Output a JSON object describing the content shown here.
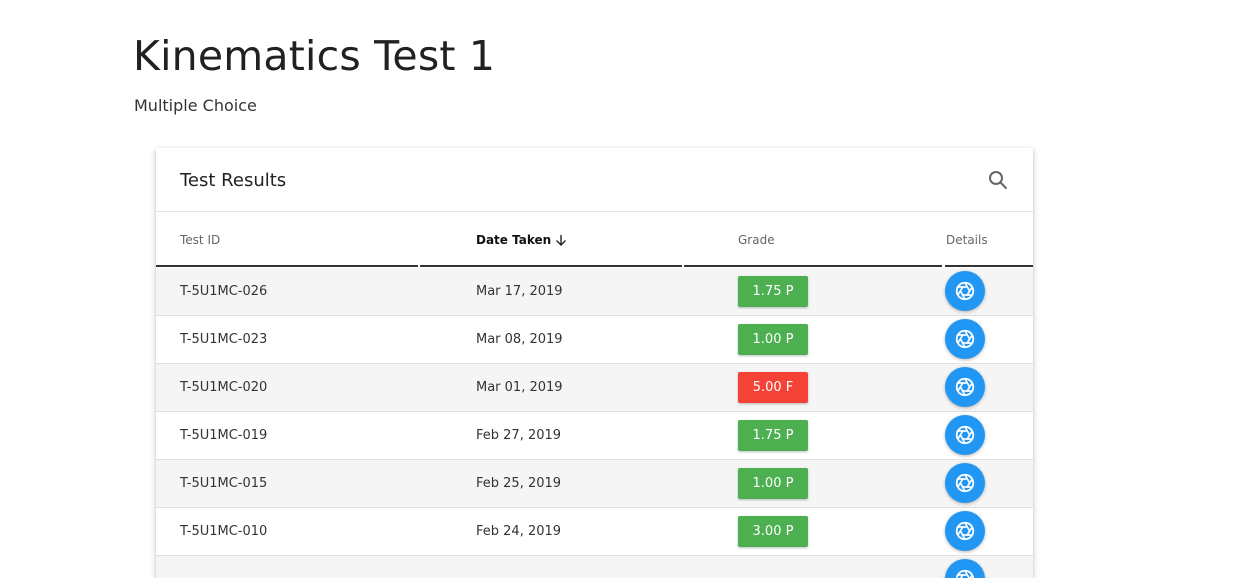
{
  "page": {
    "title": "Kinematics Test 1",
    "subtitle": "Multiple Choice"
  },
  "card": {
    "title": "Test Results",
    "search_icon": "search-icon"
  },
  "table": {
    "columns": [
      {
        "label": "Test ID"
      },
      {
        "label": "Date Taken",
        "sorted": "desc",
        "sort_icon": "arrow-down-icon"
      },
      {
        "label": "Grade"
      },
      {
        "label": "Details"
      }
    ],
    "rows": [
      {
        "test_id": "T-5U1MC-026",
        "date": "Mar 17, 2019",
        "grade": "1.75 P",
        "status": "pass"
      },
      {
        "test_id": "T-5U1MC-023",
        "date": "Mar 08, 2019",
        "grade": "1.00 P",
        "status": "pass"
      },
      {
        "test_id": "T-5U1MC-020",
        "date": "Mar 01, 2019",
        "grade": "5.00 F",
        "status": "fail"
      },
      {
        "test_id": "T-5U1MC-019",
        "date": "Feb 27, 2019",
        "grade": "1.75 P",
        "status": "pass"
      },
      {
        "test_id": "T-5U1MC-015",
        "date": "Feb 25, 2019",
        "grade": "1.00 P",
        "status": "pass"
      },
      {
        "test_id": "T-5U1MC-010",
        "date": "Feb 24, 2019",
        "grade": "3.00 P",
        "status": "pass"
      },
      {
        "test_id": "",
        "date": "",
        "grade": "",
        "status": "pass"
      }
    ],
    "details_icon": "aperture-icon"
  },
  "colors": {
    "pass": "#4caf50",
    "fail": "#f44336",
    "details_button": "#2196f3"
  }
}
